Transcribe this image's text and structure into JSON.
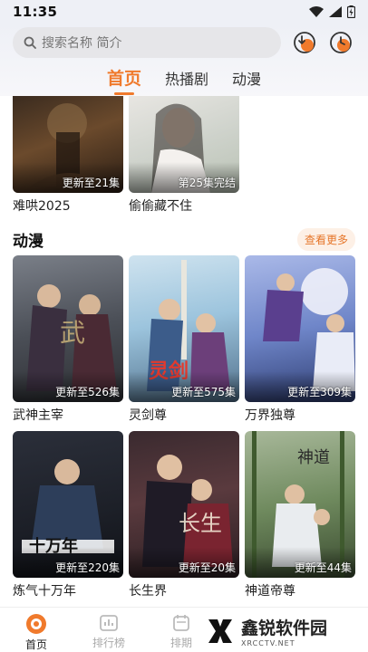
{
  "status_bar": {
    "time": "11:35"
  },
  "search": {
    "placeholder": "搜索名称 简介"
  },
  "tabs": [
    {
      "label": "首页",
      "active": true
    },
    {
      "label": "热播剧",
      "active": false
    },
    {
      "label": "动漫",
      "active": false
    }
  ],
  "prev_row": [
    {
      "title": "难哄2025",
      "episode": "更新至21集"
    },
    {
      "title": "偷偷藏不住",
      "episode": "第25集完结"
    }
  ],
  "anime_section": {
    "title": "动漫",
    "more_label": "查看更多",
    "items": [
      {
        "title": "武神主宰",
        "episode": "更新至526集"
      },
      {
        "title": "灵剑尊",
        "episode": "更新至575集"
      },
      {
        "title": "万界独尊",
        "episode": "更新至309集"
      },
      {
        "title": "炼气十万年",
        "episode": "更新至220集"
      },
      {
        "title": "长生界",
        "episode": "更新至20集"
      },
      {
        "title": "神道帝尊",
        "episode": "更新至44集"
      }
    ]
  },
  "bottom_nav": [
    {
      "label": "首页",
      "icon": "home-icon",
      "active": true
    },
    {
      "label": "排行榜",
      "icon": "ranking-icon",
      "active": false
    },
    {
      "label": "排期",
      "icon": "schedule-icon",
      "active": false
    }
  ],
  "watermark": {
    "main": "鑫锐软件园",
    "sub": "XRCCTV.NET"
  },
  "colors": {
    "accent": "#f07a2c",
    "more_bg": "#fdf0e6"
  }
}
